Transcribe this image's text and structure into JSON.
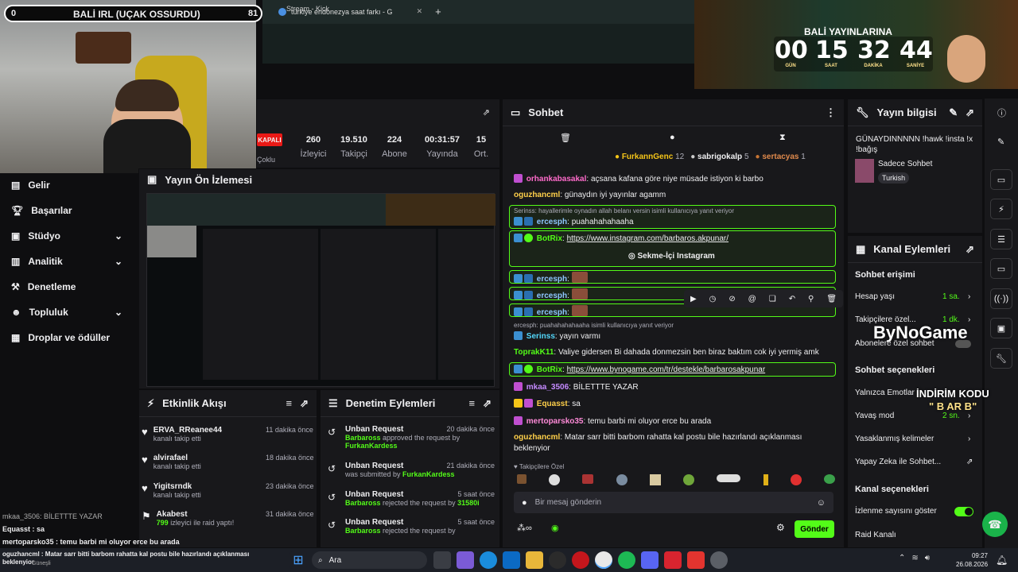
{
  "browser": {
    "tab1": "Stream - Kick",
    "tab2": "türkiye endonezya saat farkı - G",
    "new_tab": "+"
  },
  "overlay": {
    "left_num": "0",
    "title": "BALİ IRL (UÇAK OSSURDU)",
    "right_num": "81"
  },
  "promo": {
    "heading": "BALİ YAYINLARINA",
    "days": "00",
    "hours": "15",
    "minutes": "32",
    "seconds": "44",
    "days_label": "GÜN",
    "hours_label": "SAAT",
    "minutes_label": "DAKİKA",
    "seconds_label": "SANİYE"
  },
  "stream_info": {
    "status": "KAPALI",
    "status_sub": "Çoklu",
    "stats": [
      {
        "value": "260",
        "label": "İzleyici"
      },
      {
        "value": "19.510",
        "label": "Takipçi"
      },
      {
        "value": "224",
        "label": "Abone"
      },
      {
        "value": "00:31:57",
        "label": "Yayında"
      },
      {
        "value": "15",
        "label": "Ort."
      }
    ]
  },
  "nav": {
    "items": [
      {
        "label": "Gelir",
        "icon": "wallet-icon"
      },
      {
        "label": "Başarılar",
        "icon": "trophy-icon"
      },
      {
        "label": "Stüdyo",
        "icon": "studio-icon"
      },
      {
        "label": "Analitik",
        "icon": "chart-icon"
      },
      {
        "label": "Denetleme",
        "icon": "hammer-icon"
      },
      {
        "label": "Topluluk",
        "icon": "people-icon"
      },
      {
        "label": "Droplar ve ödüller",
        "icon": "gift-icon"
      }
    ]
  },
  "preview": {
    "title": "Yayın Ön İzlemesi"
  },
  "activity": {
    "title": "Etkinlik Akışı",
    "items": [
      {
        "name": "ERVA_RReanee44",
        "desc": "kanalı takip etti",
        "time": "11 dakika önce"
      },
      {
        "name": "alvirafael",
        "desc": "kanalı takip etti",
        "time": "18 dakika önce"
      },
      {
        "name": "Yigitsrndk",
        "desc": "kanalı takip etti",
        "time": "23 dakika önce"
      },
      {
        "name": "Akabest",
        "desc_num": "799",
        "desc": " izleyici ile raid yaptı!",
        "time": "31 dakika önce"
      }
    ]
  },
  "moderation": {
    "title": "Denetim Eylemleri",
    "items": [
      {
        "title": "Unban Request",
        "time": "20 dakika önce",
        "actor": "Barbaross",
        "action": " approved the request by",
        "target": "FurkanKardess"
      },
      {
        "title": "Unban Request",
        "time": "21 dakika önce",
        "actor": "",
        "action": "was submitted by ",
        "target": "FurkanKardess"
      },
      {
        "title": "Unban Request",
        "time": "5 saat önce",
        "actor": "Barbaross",
        "action": " rejected the request by ",
        "target": "31580i"
      },
      {
        "title": "Unban Request",
        "time": "5 saat önce",
        "actor": "Barbaross",
        "action": " rejected the request by",
        "target": ""
      }
    ]
  },
  "chat": {
    "title": "Sohbet",
    "top_chatters": [
      {
        "name": "FurkannGenc",
        "count": "12"
      },
      {
        "name": "sabrigokalp",
        "count": "5"
      },
      {
        "name": "sertacyas",
        "count": "1"
      }
    ],
    "messages": [
      {
        "user": "orhankabasakal",
        "text": "açsana kafana göre niye müsade istiyon ki barbo",
        "color": "#ff6bcb"
      },
      {
        "user": "oguzhancml",
        "text": "günaydın iyi yayınlar agamm",
        "color": "#ffd04a"
      }
    ],
    "reply1": "Serinss: hayallerimle oynadın allah belanı versin isimli kullanıcıya yanıt veriyor",
    "r1_user": "ercesph",
    "r1_text": "puahahahahaaha",
    "bot1_user": "BotRix",
    "bot1_link": "https://www.instagram.com/barbaros.akpunar/",
    "bot1_button": "Sekme-İçi Instagram",
    "emote_user": "ercesph",
    "reply2": "ercesph: puahahahahaaha isimli kullanıcıya yanıt veriyor",
    "serinss_user": "Serinss",
    "serinss_text": "yayın varmı",
    "toprak_user": "ToprakK11",
    "toprak_text": "Valiye gidersen Bi dahada donmezsin ben biraz baktım cok iyi yermiş amk",
    "bot2_user": "BotRix",
    "bot2_link": "https://www.bynogame.com/tr/destekle/barbarosakpunar",
    "mkaa_user": "mkaa_3506",
    "mkaa_text": "BİLETTTE YAZAR",
    "equasst_user": "Equasst",
    "equasst_text": "sa",
    "merto_user": "mertoparsko35",
    "merto_text": "temu barbi mi oluyor erce bu arada",
    "oguz2_user": "oguzhancml",
    "oguz2_text": "Matar sarr bitti barbom rahatta kal postu bile hazırlandı açıklanması",
    "oguz2_text2": "beklenyior",
    "followers_label": "Takipçilere Özel",
    "input_placeholder": "Bir mesaj gönderin",
    "send": "Gönder"
  },
  "right": {
    "info_title": "Yayın bilgisi",
    "info_text": "GÜNAYDINNNNN !hawk !insta !x !bağış",
    "category": "Sadece Sohbet",
    "tag": "Turkish",
    "actions_title": "Kanal Eylemleri",
    "chat_access": "Sohbet erişimi",
    "account_age": "Hesap yaşı",
    "account_age_val": "1 sa.",
    "followers_only": "Takipçilere özel...",
    "followers_only_val": "1 dk.",
    "subs_only": "Abonelere özel sohbet",
    "chat_options": "Sohbet seçenekleri",
    "emotes_only": "Yalnızca Emotlar",
    "slow": "Yavaş mod",
    "slow_val": "2 sn.",
    "banned_words": "Yasaklanmış kelimeler",
    "ai": "Yapay Zeka ile Sohbet...",
    "channel_options": "Kanal seçenekleri",
    "show_views": "İzlenme sayısını göster",
    "raid": "Raid Kanalı"
  },
  "promo_overlay": {
    "brand": "ByNoGame",
    "code_title": "İNDİRİM KODU",
    "code": "\" B AR B\""
  },
  "stream_chat_overlay": [
    {
      "user": "mkaa_3506",
      "text": ": BİLETTTE YAZAR"
    },
    {
      "user": "Equasst",
      "text": " : sa"
    },
    {
      "user": "mertoparsko35",
      "text": " : temu barbi mi oluyor erce bu arada"
    },
    {
      "user": "oguzhancml",
      "text": " : Matar sarr bitti barbom rahatta kal postu bile hazırlandı açıklanması"
    },
    {
      "user": "",
      "text": "beklenyior"
    }
  ],
  "taskbar": {
    "search": "Ara",
    "time": "09:27",
    "date": "26.08.2026",
    "weather": "Güneşli"
  },
  "colors": {
    "accent": "#53fc18",
    "bg": "#0e0e10",
    "panel": "#18181b"
  }
}
